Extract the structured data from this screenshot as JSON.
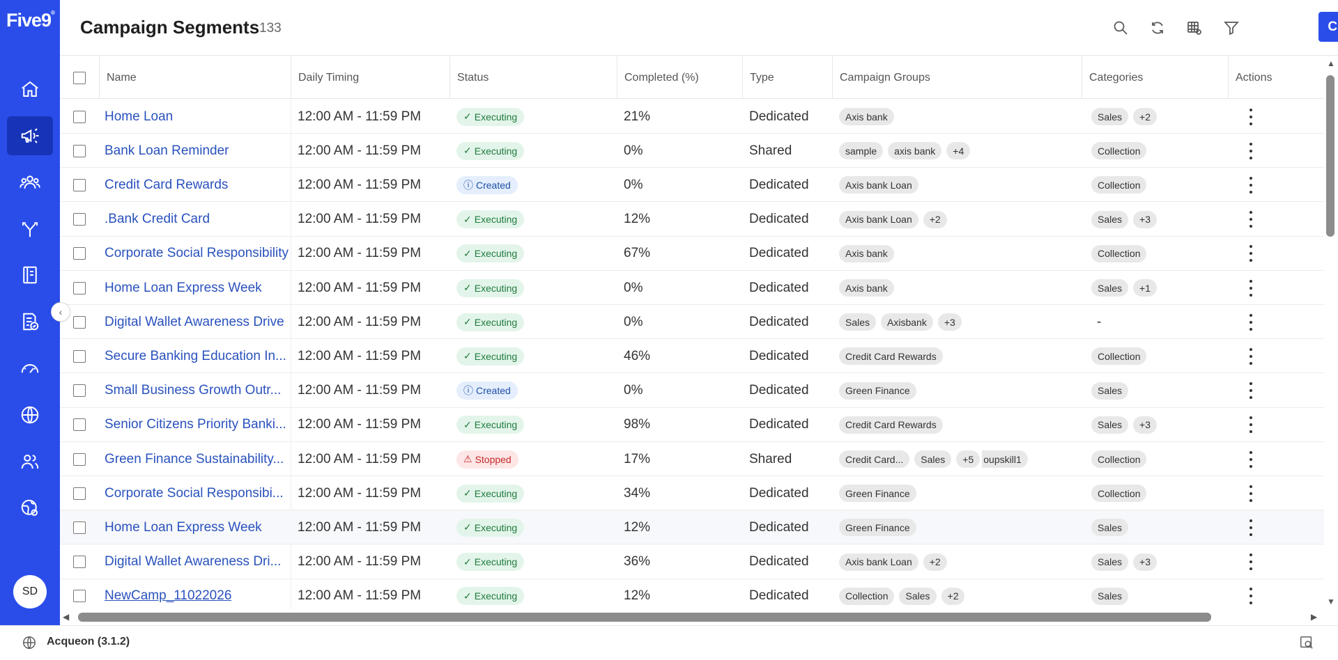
{
  "sidebar": {
    "logo": "Five9",
    "logo_mark": "®",
    "items": [
      {
        "icon": "home-icon"
      },
      {
        "icon": "megaphone-icon",
        "active": true
      },
      {
        "icon": "users-group-icon"
      },
      {
        "icon": "routing-arrows-icon"
      },
      {
        "icon": "book-icon"
      },
      {
        "icon": "report-check-icon"
      },
      {
        "icon": "speedometer-icon"
      },
      {
        "icon": "globe-icon"
      },
      {
        "icon": "people-icon"
      },
      {
        "icon": "settings-globe-icon"
      }
    ],
    "avatar_initials": "SD"
  },
  "header": {
    "title": "Campaign Segments",
    "count": "133",
    "create_label": "Create"
  },
  "table": {
    "columns": {
      "name": "Name",
      "timing": "Daily Timing",
      "status": "Status",
      "completed": "Completed (%)",
      "type": "Type",
      "groups": "Campaign Groups",
      "categories": "Categories",
      "actions": "Actions"
    },
    "rows": [
      {
        "name": "Home Loan",
        "timing": "12:00 AM - 11:59 PM",
        "status": "Executing",
        "status_kind": "exec",
        "completed": "21%",
        "type": "Dedicated",
        "groups": [
          "Axis bank"
        ],
        "categories": [
          "Sales",
          "+2"
        ]
      },
      {
        "name": "Bank Loan Reminder",
        "timing": "12:00 AM - 11:59 PM",
        "status": "Executing",
        "status_kind": "exec",
        "completed": "0%",
        "type": "Shared",
        "groups": [
          "sample",
          "axis bank",
          "+4"
        ],
        "categories": [
          "Collection"
        ]
      },
      {
        "name": "Credit Card Rewards",
        "timing": "12:00 AM - 11:59 PM",
        "status": "Created",
        "status_kind": "created",
        "completed": "0%",
        "type": "Dedicated",
        "groups": [
          "Axis bank Loan"
        ],
        "categories": [
          "Collection"
        ]
      },
      {
        "name": ".Bank Credit Card",
        "timing": "12:00 AM - 11:59 PM",
        "status": "Executing",
        "status_kind": "exec",
        "completed": "12%",
        "type": "Dedicated",
        "groups": [
          "Axis bank Loan",
          "+2"
        ],
        "categories": [
          "Sales",
          "+3"
        ]
      },
      {
        "name": "Corporate Social Responsibility",
        "timing": "12:00 AM - 11:59 PM",
        "status": "Executing",
        "status_kind": "exec",
        "completed": "67%",
        "type": "Dedicated",
        "groups": [
          "Axis bank"
        ],
        "categories": [
          "Collection"
        ]
      },
      {
        "name": "Home Loan Express Week",
        "timing": "12:00 AM - 11:59 PM",
        "status": "Executing",
        "status_kind": "exec",
        "completed": "0%",
        "type": "Dedicated",
        "groups": [
          "Axis bank"
        ],
        "categories": [
          "Sales",
          "+1"
        ]
      },
      {
        "name": "Digital Wallet Awareness Drive",
        "timing": "12:00 AM - 11:59 PM",
        "status": "Executing",
        "status_kind": "exec",
        "completed": "0%",
        "type": "Dedicated",
        "groups": [
          "Sales",
          "Axisbank",
          "+3"
        ],
        "categories_text": "-"
      },
      {
        "name": "Secure Banking Education In...",
        "timing": "12:00 AM - 11:59 PM",
        "status": "Executing",
        "status_kind": "exec",
        "completed": "46%",
        "type": "Dedicated",
        "groups": [
          "Credit Card Rewards"
        ],
        "categories": [
          "Collection"
        ]
      },
      {
        "name": "Small Business Growth Outr...",
        "timing": "12:00 AM - 11:59 PM",
        "status": "Created",
        "status_kind": "created",
        "completed": "0%",
        "type": "Dedicated",
        "groups": [
          "Green Finance"
        ],
        "categories": [
          "Sales"
        ]
      },
      {
        "name": "Senior Citizens Priority Banki...",
        "timing": "12:00 AM - 11:59 PM",
        "status": "Executing",
        "status_kind": "exec",
        "completed": "98%",
        "type": "Dedicated",
        "groups": [
          "Credit Card Rewards"
        ],
        "categories": [
          "Sales",
          "+3"
        ]
      },
      {
        "name": "Green Finance Sustainability...",
        "timing": "12:00 AM - 11:59 PM",
        "status": "Stopped",
        "status_kind": "stopped",
        "completed": "17%",
        "type": "Shared",
        "groups": [
          "Credit Card...",
          "Sales",
          "+5"
        ],
        "groups_overflow": "oupskill1",
        "categories": [
          "Collection"
        ]
      },
      {
        "name": "Corporate Social Responsibi...",
        "timing": "12:00 AM - 11:59 PM",
        "status": "Executing",
        "status_kind": "exec",
        "completed": "34%",
        "type": "Dedicated",
        "groups": [
          "Green Finance"
        ],
        "categories": [
          "Collection"
        ]
      },
      {
        "name": "Home Loan Express Week",
        "timing": "12:00 AM - 11:59 PM",
        "status": "Executing",
        "status_kind": "exec",
        "completed": "12%",
        "type": "Dedicated",
        "groups": [
          "Green Finance"
        ],
        "categories": [
          "Sales"
        ],
        "highlight": true
      },
      {
        "name": "Digital Wallet Awareness Dri...",
        "timing": "12:00 AM - 11:59 PM",
        "status": "Executing",
        "status_kind": "exec",
        "completed": "36%",
        "type": "Dedicated",
        "groups": [
          "Axis bank Loan",
          "+2"
        ],
        "categories": [
          "Sales",
          "+3"
        ]
      },
      {
        "name": "NewCamp_11022026",
        "timing": "12:00 AM - 11:59 PM",
        "status": "Executing",
        "status_kind": "exec",
        "completed": "12%",
        "type": "Dedicated",
        "groups": [
          "Collection",
          "Sales",
          "+2"
        ],
        "categories": [
          "Sales"
        ],
        "underline": true
      }
    ]
  },
  "footer": {
    "label": "Acqueon (3.1.2)"
  },
  "colors": {
    "brand": "#2a4dea",
    "sidebar_active": "#1734b8",
    "link": "#2a52be"
  }
}
